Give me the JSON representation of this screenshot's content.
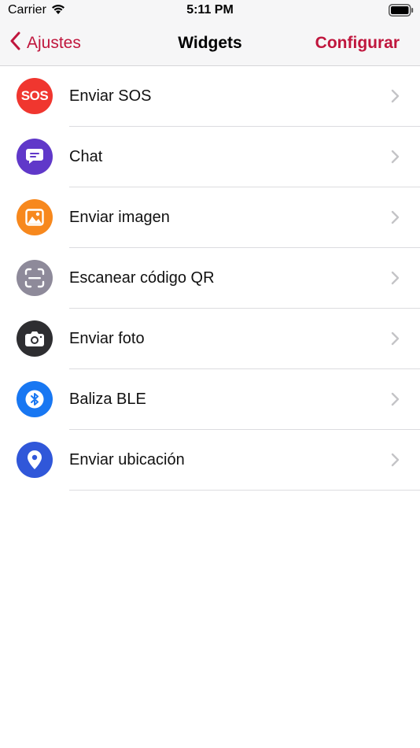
{
  "status_bar": {
    "carrier": "Carrier",
    "time": "5:11 PM"
  },
  "nav": {
    "back_label": "Ajustes",
    "title": "Widgets",
    "action_label": "Configurar"
  },
  "colors": {
    "accent": "#c0163d"
  },
  "widgets": [
    {
      "label": "Enviar SOS",
      "icon": "sos-icon",
      "color": "#f0362f",
      "icon_text": "SOS"
    },
    {
      "label": "Chat",
      "icon": "chat-bubble-icon",
      "color": "#6038c9"
    },
    {
      "label": "Enviar imagen",
      "icon": "image-icon",
      "color": "#f7881d"
    },
    {
      "label": "Escanear código QR",
      "icon": "qr-scan-icon",
      "color": "#8e8a9a"
    },
    {
      "label": "Enviar foto",
      "icon": "camera-icon",
      "color": "#2e2e31"
    },
    {
      "label": "Baliza BLE",
      "icon": "bluetooth-icon",
      "color": "#1877f2"
    },
    {
      "label": "Enviar ubicación",
      "icon": "location-pin-icon",
      "color": "#3057d9"
    }
  ]
}
